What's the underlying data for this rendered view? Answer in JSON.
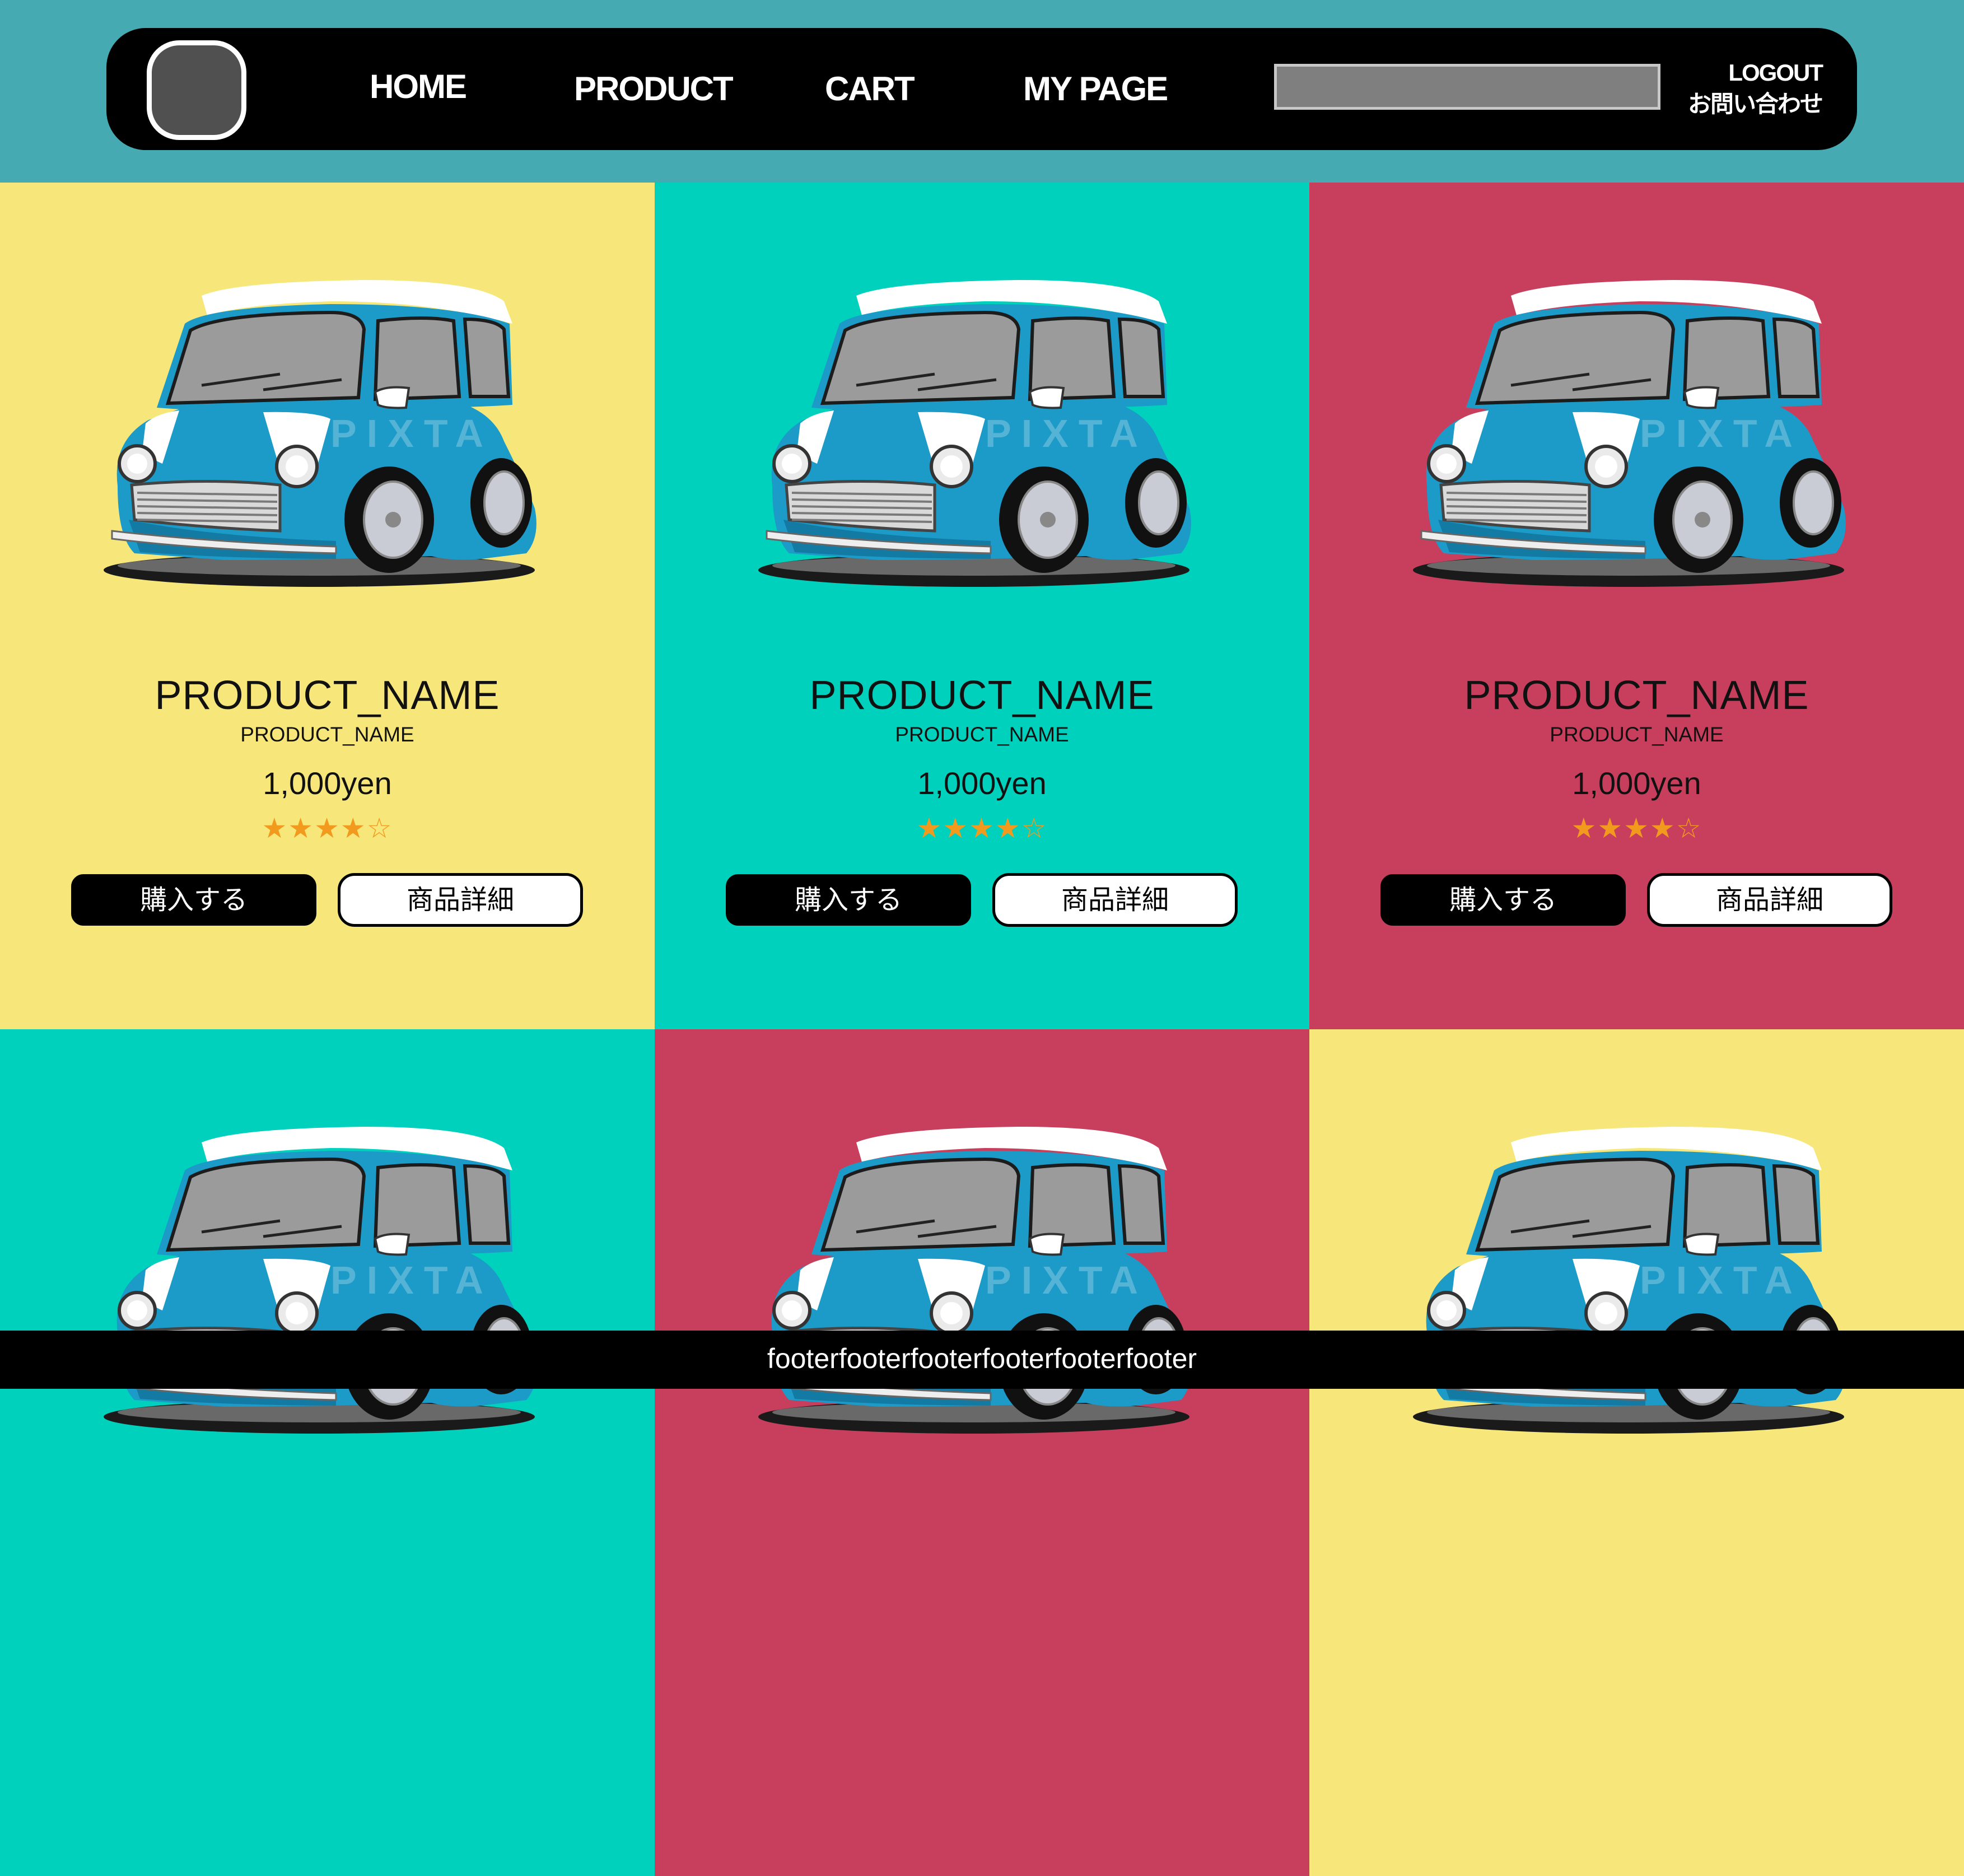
{
  "header": {
    "nav": [
      "HOME",
      "PRODUCT",
      "CART",
      "MY PAGE"
    ],
    "search_placeholder": "",
    "logout": "LOGOUT",
    "contact": "お問い合わせ"
  },
  "colors": {
    "header_bg": "#45aab2",
    "yellow": "#f7e77b",
    "teal": "#00d1bd",
    "red": "#c83f5d",
    "star": "#f29a1e",
    "car_body": "#1c9ac8"
  },
  "products": [
    {
      "name": "PRODUCT_NAME",
      "subname": "PRODUCT_NAME",
      "price": "1,000yen",
      "rating": "★★★★☆",
      "rating_value": 4,
      "buy_label": "購入する",
      "detail_label": "商品詳細",
      "bg": "#f7e77b"
    },
    {
      "name": "PRODUCT_NAME",
      "subname": "PRODUCT_NAME",
      "price": "1,000yen",
      "rating": "★★★★☆",
      "rating_value": 4,
      "buy_label": "購入する",
      "detail_label": "商品詳細",
      "bg": "#00d1bd"
    },
    {
      "name": "PRODUCT_NAME",
      "subname": "PRODUCT_NAME",
      "price": "1,000yen",
      "rating": "★★★★☆",
      "rating_value": 4,
      "buy_label": "購入する",
      "detail_label": "商品詳細",
      "bg": "#c83f5d"
    },
    {
      "bg": "#00d1bd"
    },
    {
      "bg": "#c83f5d"
    },
    {
      "bg": "#f7e77b"
    }
  ],
  "car_image": {
    "icon": "mini-cooper-car-illustration",
    "watermark": "PIXTA"
  },
  "footer": {
    "text": "footerfooterfooterfooterfooterfooter"
  }
}
